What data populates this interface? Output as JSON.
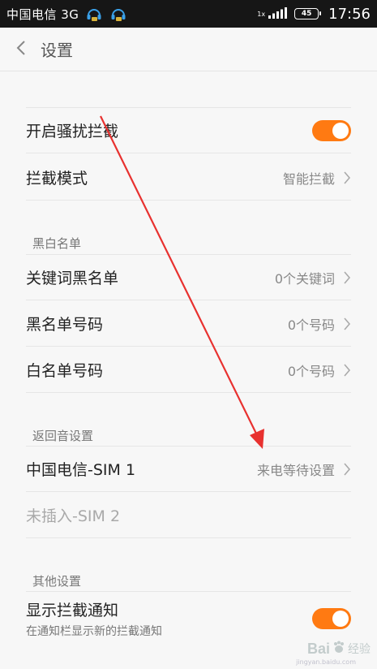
{
  "statusbar": {
    "carrier": "中国电信 3G",
    "speed": "1x",
    "battery": "45",
    "time": "17:56"
  },
  "header": {
    "title": "设置"
  },
  "block1": {
    "harass_label": "开启骚扰拦截",
    "harass_on": true,
    "mode_label": "拦截模式",
    "mode_value": "智能拦截"
  },
  "lists": {
    "section": "黑白名单",
    "keyword_label": "关键词黑名单",
    "keyword_value": "0个关键词",
    "black_label": "黑名单号码",
    "black_value": "0个号码",
    "white_label": "白名单号码",
    "white_value": "0个号码"
  },
  "callback": {
    "section": "返回音设置",
    "sim1_label": "中国电信-SIM 1",
    "sim1_value": "来电等待设置",
    "sim2_label": "未插入-SIM 2"
  },
  "other": {
    "section": "其他设置",
    "notify_label": "显示拦截通知",
    "notify_desc": "在通知栏显示新的拦截通知",
    "notify_on": true
  },
  "watermark": {
    "brand": "Bai",
    "brand_cn": "经验",
    "url": "jingyan.baidu.com"
  },
  "colors": {
    "accent": "#ff7a12",
    "arrow": "#e8312f"
  },
  "icons": [
    "headset-icon",
    "signal-icon",
    "battery-icon",
    "back-chevron-icon",
    "chevron-right-icon",
    "baidu-paw-icon"
  ]
}
